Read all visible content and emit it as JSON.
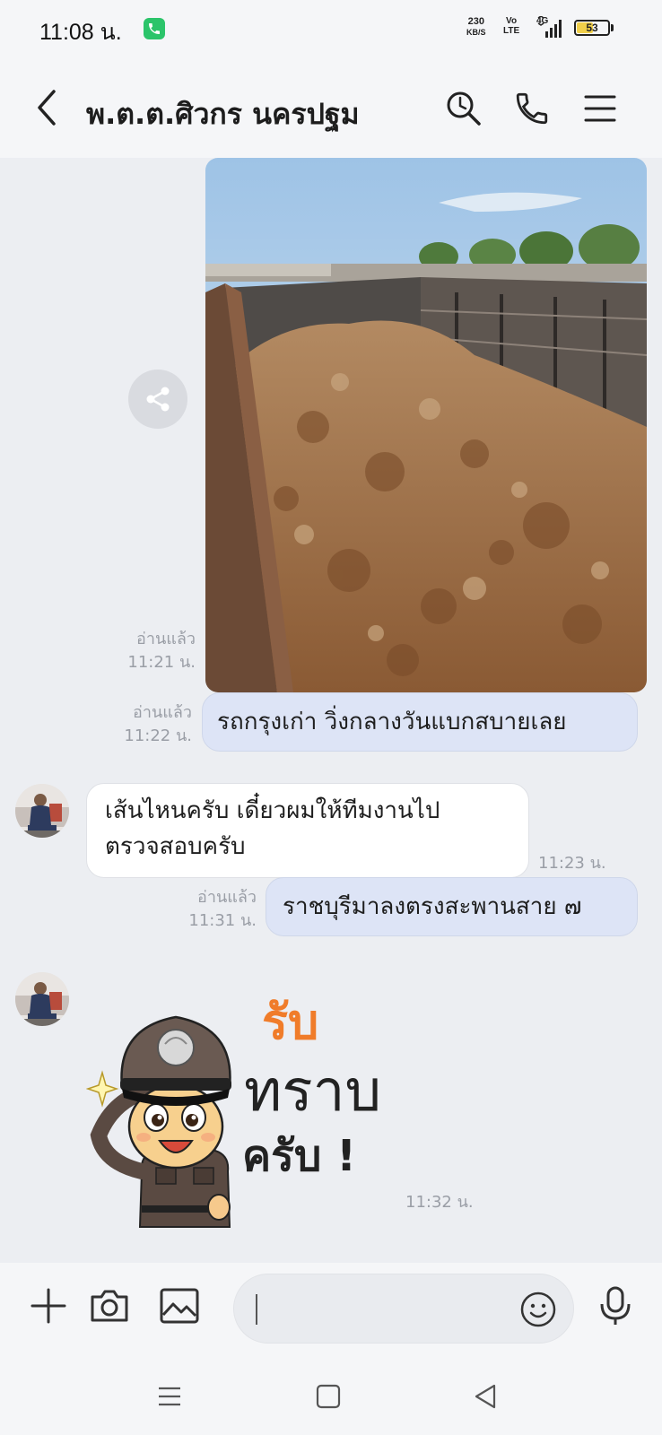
{
  "status_bar": {
    "time": "11:08 น.",
    "net_speed_value": "230",
    "net_speed_unit": "KB/S",
    "volte_top": "Vo",
    "volte_bottom": "LTE",
    "network": "4G",
    "battery_level": "53",
    "battery_fraction": 0.53
  },
  "header": {
    "title": "พ.ต.ต.ศิวกร นครปฐม",
    "icons": [
      "back-icon",
      "search-icon",
      "phone-icon",
      "menu-icon"
    ]
  },
  "messages": {
    "photo": {
      "read": "อ่านแล้ว",
      "time": "11:21 น."
    },
    "out1": {
      "text": "รถกรุงเก่า วิ่งกลางวันแบกสบายเลย",
      "read": "อ่านแล้ว",
      "time": "11:22 น."
    },
    "in1": {
      "line1": "เส้นไหนครับ เดี๋ยวผมให้ทีมงานไป",
      "line2": "ตรวจสอบครับ",
      "time": "11:23 น."
    },
    "out2": {
      "text": "ราชบุรีมาลงตรงสะพานสาย ๗",
      "read": "อ่านแล้ว",
      "time": "11:31 น."
    },
    "sticker": {
      "line1": "รับ",
      "line2": "ทราบ",
      "line3": "ครับ !",
      "time": "11:32 น."
    }
  },
  "input_bar": {
    "placeholder": "",
    "icons": [
      "plus-icon",
      "camera-icon",
      "gallery-icon",
      "emoji-icon",
      "mic-icon"
    ]
  },
  "nav_bar": {
    "icons": [
      "recents-icon",
      "home-icon",
      "back-nav-icon"
    ]
  },
  "colors": {
    "background": "#eceef2",
    "bar": "#f5f6f8",
    "outgoing_bubble": "#dde4f6",
    "incoming_bubble": "#ffffff",
    "meta_text": "#9a9ea6",
    "sticker_orange": "#f07c2a"
  }
}
